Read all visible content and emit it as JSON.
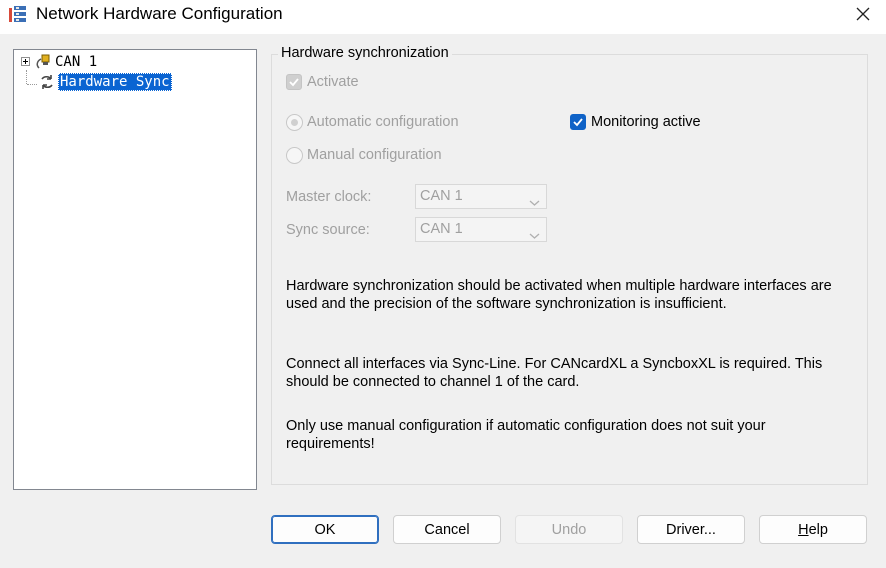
{
  "window": {
    "title": "Network Hardware Configuration",
    "icon": "network-config-icon",
    "close_glyph": "✕"
  },
  "tree": {
    "items": [
      {
        "label": "CAN 1",
        "icon": "can-node-icon",
        "expanded": false,
        "selected": false
      },
      {
        "label": "Hardware Sync",
        "icon": "sync-arrows-icon",
        "selected": true
      }
    ]
  },
  "group": {
    "legend": "Hardware synchronization",
    "activate": {
      "label": "Activate",
      "checked": true,
      "enabled": false
    },
    "auto_config": {
      "label": "Automatic configuration",
      "selected": true,
      "enabled": false
    },
    "manual_config": {
      "label": "Manual configuration",
      "selected": false,
      "enabled": false
    },
    "monitoring": {
      "label": "Monitoring active",
      "checked": true,
      "enabled": true
    },
    "master_clock": {
      "label": "Master clock:",
      "value": "CAN 1"
    },
    "sync_source": {
      "label": "Sync source:",
      "value": "CAN 1"
    },
    "info": [
      "Hardware synchronization should be activated when multiple hardware interfaces are used and the precision of the software synchronization is insufficient.",
      "Connect all interfaces via Sync-Line. For CANcardXL a SyncboxXL is required. This should be connected to channel 1 of the card.",
      "Only use manual configuration if automatic configuration does not suit your requirements!"
    ]
  },
  "buttons": {
    "ok": "OK",
    "cancel": "Cancel",
    "undo": "Undo",
    "driver": "Driver...",
    "help_first": "H",
    "help_rest": "elp"
  },
  "colors": {
    "accent": "#0f62c7",
    "selection": "#0a64d2",
    "disabled_text": "#a0a0a0"
  }
}
